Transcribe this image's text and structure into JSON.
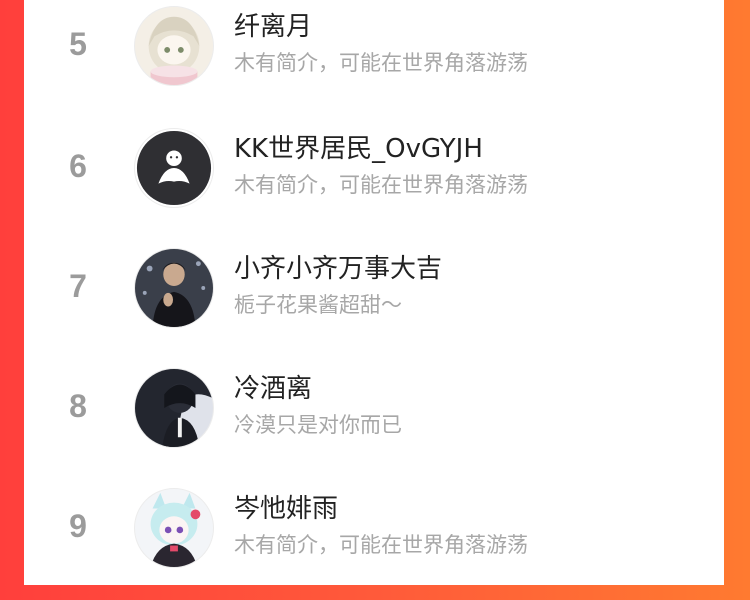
{
  "list": [
    {
      "rank": "5",
      "name": "纤离月",
      "bio": "木有简介，可能在世界角落游荡",
      "avatar_icon": "anime-girl-avatar"
    },
    {
      "rank": "6",
      "name": "KK世界居民_OvGYJH",
      "bio": "木有简介，可能在世界角落游荡",
      "avatar_icon": "default-ghost-avatar"
    },
    {
      "rank": "7",
      "name": "小齐小齐万事大吉",
      "bio": "栀子花果酱超甜～",
      "avatar_icon": "man-photo-avatar"
    },
    {
      "rank": "8",
      "name": "冷酒离",
      "bio": "冷漠只是对你而已",
      "avatar_icon": "dark-anime-avatar"
    },
    {
      "rank": "9",
      "name": "岑忚婔雨",
      "bio": "木有简介，可能在世界角落游荡",
      "avatar_icon": "cat-ear-girl-avatar"
    }
  ],
  "colors": {
    "background_left": "#ff3f3c",
    "background_right": "#ff7a30",
    "rank": "#9b9b9b",
    "name": "#222222",
    "bio": "#a7a7a7"
  }
}
